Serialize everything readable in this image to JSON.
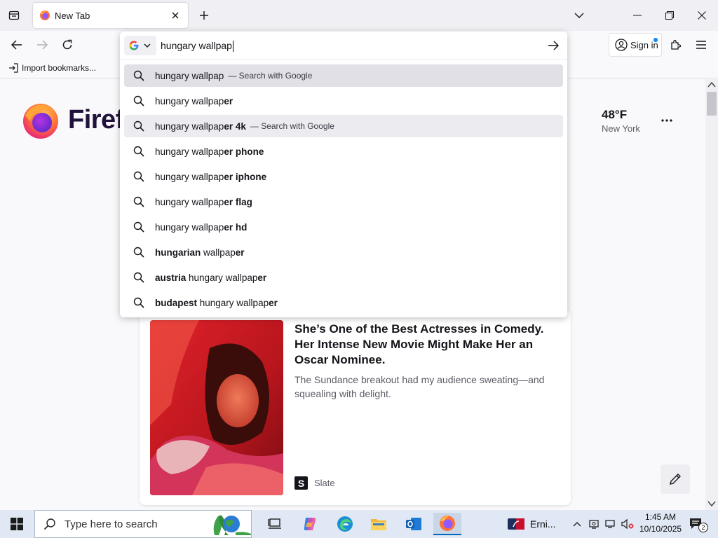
{
  "tab": {
    "title": "New Tab"
  },
  "navbar": {
    "signin_label": "Sign in"
  },
  "bookmarks": {
    "import_label": "Import bookmarks..."
  },
  "urlbar": {
    "value": "hungary wallpap",
    "engine": "google-icon",
    "suggestions": [
      {
        "pre": "",
        "typed": "hungary wallpap",
        "rest": "",
        "action": "— Search with Google",
        "state": "selected"
      },
      {
        "pre": "",
        "typed": "hungary wallpap",
        "rest": "er",
        "action": "",
        "state": ""
      },
      {
        "pre": "",
        "typed": "hungary wallpap",
        "rest": "er 4k",
        "action": "— Search with Google",
        "state": "hover"
      },
      {
        "pre": "",
        "typed": "hungary wallpap",
        "rest": "er phone",
        "action": "",
        "state": ""
      },
      {
        "pre": "",
        "typed": "hungary wallpap",
        "rest": "er iphone",
        "action": "",
        "state": ""
      },
      {
        "pre": "",
        "typed": "hungary wallpap",
        "rest": "er flag",
        "action": "",
        "state": ""
      },
      {
        "pre": "",
        "typed": "hungary wallpap",
        "rest": "er hd",
        "action": "",
        "state": ""
      },
      {
        "pre": "hungarian",
        "typed": " wallpap",
        "rest": "er",
        "action": "",
        "state": ""
      },
      {
        "pre": "austria",
        "typed": " hungary wallpap",
        "rest": "er",
        "action": "",
        "state": ""
      },
      {
        "pre": "budapest",
        "typed": " hungary wallpap",
        "rest": "er",
        "action": "",
        "state": ""
      }
    ]
  },
  "page": {
    "brand": "Firefox",
    "weather": {
      "temp": "48°F",
      "city": "New York"
    },
    "story": {
      "title": "She’s One of the Best Actresses in Comedy. Her Intense New Movie Might Make Her an Oscar Nominee.",
      "description": "The Sundance breakout had my audience sweating—and squealing with delight.",
      "source": "Slate",
      "source_logo": "S"
    }
  },
  "taskbar": {
    "search_placeholder": "Type here to search",
    "widget_label": "Erni...",
    "time": "1:45 AM",
    "date": "10/10/2025",
    "notification_count": "2"
  },
  "colors": {
    "accent": "#0a84ff",
    "brand_dark": "#20123a",
    "firefox_orange": "#ff7139",
    "firefox_purple": "#9059ff"
  }
}
